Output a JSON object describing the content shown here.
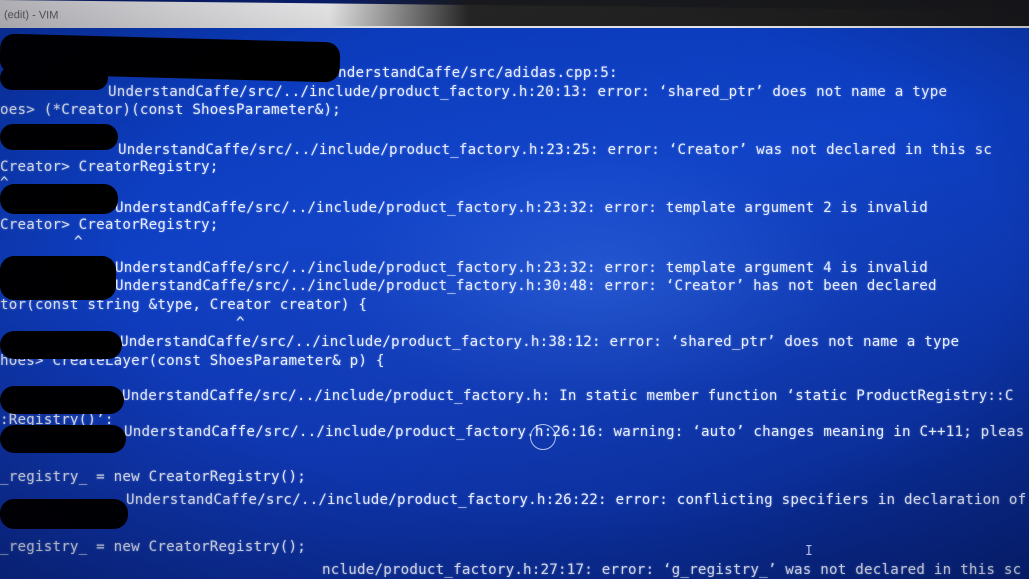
{
  "window": {
    "title": "(edit) - VIM"
  },
  "terminal": {
    "lines": [
      "nderstandCaffe/src/adidas.cpp:5:",
      "UnderstandCaffe/src/../include/product_factory.h:20:13: error: ‘shared_ptr’ does not name a type",
      "oes> (*Creator)(const ShoesParameter&);",
      "UnderstandCaffe/src/../include/product_factory.h:23:25: error: ‘Creator’ was not declared in this sc",
      "Creator> CreatorRegistry;",
      "^",
      "UnderstandCaffe/src/../include/product_factory.h:23:32: error: template argument 2 is invalid",
      "Creator> CreatorRegistry;",
      "^",
      "UnderstandCaffe/src/../include/product_factory.h:23:32: error: template argument 4 is invalid",
      "UnderstandCaffe/src/../include/product_factory.h:30:48: error: ‘Creator’ has not been declared",
      "tor(const string &type, Creator creator) {",
      "^",
      "UnderstandCaffe/src/../include/product_factory.h:38:12: error: ‘shared_ptr’ does not name a type",
      "hoes> CreateLayer(const ShoesParameter& p) {",
      "UnderstandCaffe/src/../include/product_factory.h: In static member function ‘static ProductRegistry::C",
      ":Registry()’:",
      "UnderstandCaffe/src/../include/product_factory.h:26:16: warning: ‘auto’ changes meaning in C++11; pleas",
      "_registry_ = new CreatorRegistry();",
      "UnderstandCaffe/src/../include/product_factory.h:26:22: error: conflicting specifiers in declaration of",
      "_registry_ = new CreatorRegistry();",
      "nclude/product_factory.h:27:17: error: ‘g_registry_’ was not declared in this sc"
    ],
    "ibeam_glyph": "I"
  },
  "colors": {
    "terminal_bg": "#0b3ab8",
    "text": "#e8eeff",
    "redaction": "#000000"
  }
}
